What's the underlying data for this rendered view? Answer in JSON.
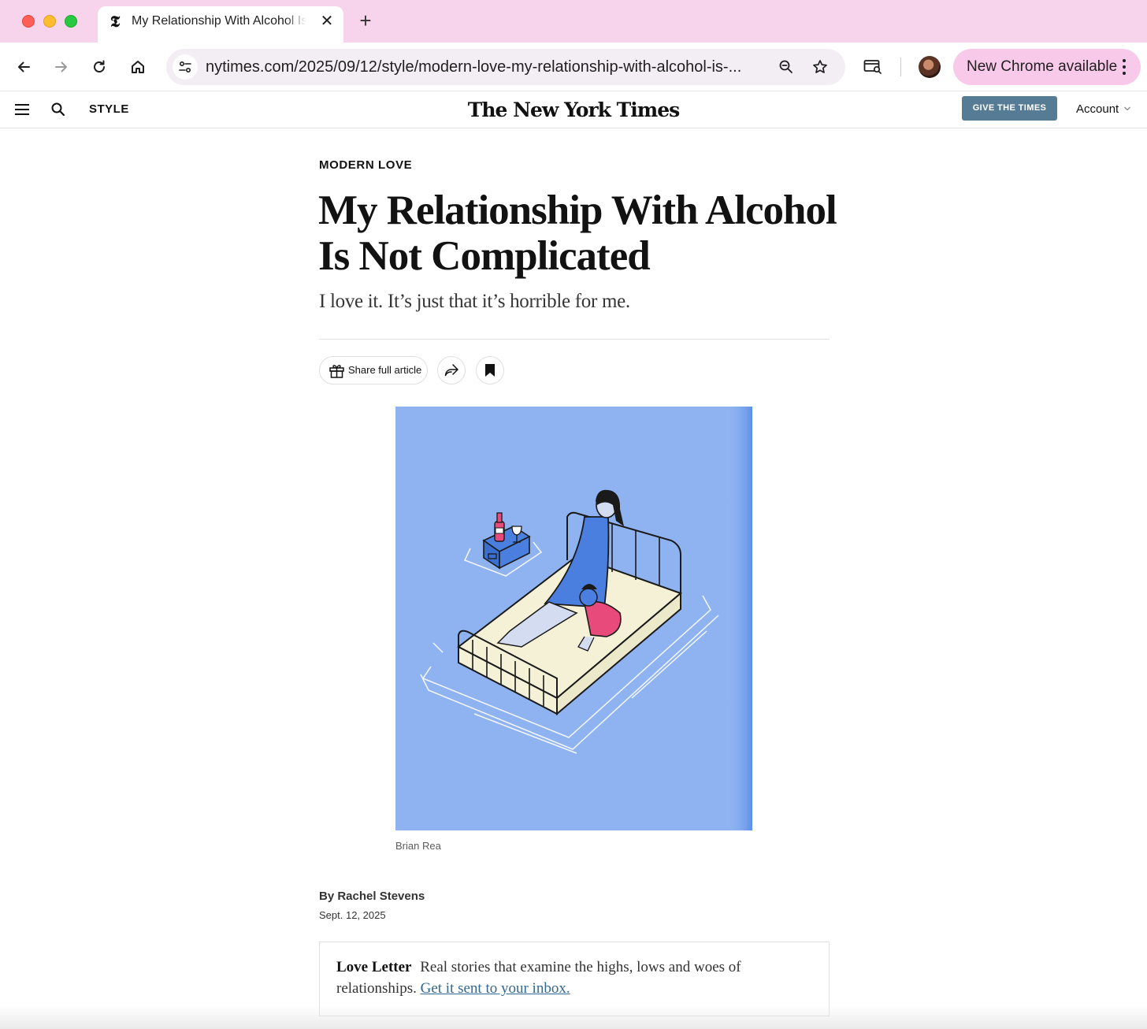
{
  "browser": {
    "tab": {
      "favicon": "nyt-t-logo-icon",
      "title": "My Relationship With Alcohol Is Not Complicated"
    },
    "toolbar": {
      "url": "nytimes.com/2025/09/12/style/modern-love-my-relationship-with-alcohol-is-...",
      "update_label": "New Chrome available"
    },
    "colors": {
      "tab_strip": "#f7d4ec",
      "update_pill": "#f9c9ea"
    }
  },
  "nyt_header": {
    "section": "STYLE",
    "logo": "The New York Times",
    "give_button": "GIVE THE TIMES",
    "account": "Account"
  },
  "article": {
    "kicker": "MODERN LOVE",
    "headline": "My Relationship With Alcohol Is Not Complicated",
    "dek": "I love it. It’s just that it’s horrible for me.",
    "share_label": "Share full article",
    "image_credit": "Brian Rea",
    "byline": "By Rachel Stevens",
    "date": "Sept. 12, 2025"
  },
  "newsletter": {
    "name": "Love Letter",
    "description": "Real stories that examine the highs, lows and woes of relationships.",
    "link_text": "Get it sent to your inbox."
  }
}
